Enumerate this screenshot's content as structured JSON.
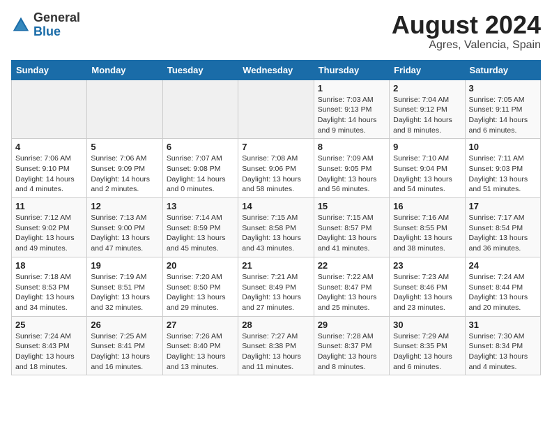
{
  "logo": {
    "general": "General",
    "blue": "Blue"
  },
  "title": "August 2024",
  "subtitle": "Agres, Valencia, Spain",
  "weekdays": [
    "Sunday",
    "Monday",
    "Tuesday",
    "Wednesday",
    "Thursday",
    "Friday",
    "Saturday"
  ],
  "weeks": [
    [
      {
        "day": "",
        "info": ""
      },
      {
        "day": "",
        "info": ""
      },
      {
        "day": "",
        "info": ""
      },
      {
        "day": "",
        "info": ""
      },
      {
        "day": "1",
        "info": "Sunrise: 7:03 AM\nSunset: 9:13 PM\nDaylight: 14 hours\nand 9 minutes."
      },
      {
        "day": "2",
        "info": "Sunrise: 7:04 AM\nSunset: 9:12 PM\nDaylight: 14 hours\nand 8 minutes."
      },
      {
        "day": "3",
        "info": "Sunrise: 7:05 AM\nSunset: 9:11 PM\nDaylight: 14 hours\nand 6 minutes."
      }
    ],
    [
      {
        "day": "4",
        "info": "Sunrise: 7:06 AM\nSunset: 9:10 PM\nDaylight: 14 hours\nand 4 minutes."
      },
      {
        "day": "5",
        "info": "Sunrise: 7:06 AM\nSunset: 9:09 PM\nDaylight: 14 hours\nand 2 minutes."
      },
      {
        "day": "6",
        "info": "Sunrise: 7:07 AM\nSunset: 9:08 PM\nDaylight: 14 hours\nand 0 minutes."
      },
      {
        "day": "7",
        "info": "Sunrise: 7:08 AM\nSunset: 9:06 PM\nDaylight: 13 hours\nand 58 minutes."
      },
      {
        "day": "8",
        "info": "Sunrise: 7:09 AM\nSunset: 9:05 PM\nDaylight: 13 hours\nand 56 minutes."
      },
      {
        "day": "9",
        "info": "Sunrise: 7:10 AM\nSunset: 9:04 PM\nDaylight: 13 hours\nand 54 minutes."
      },
      {
        "day": "10",
        "info": "Sunrise: 7:11 AM\nSunset: 9:03 PM\nDaylight: 13 hours\nand 51 minutes."
      }
    ],
    [
      {
        "day": "11",
        "info": "Sunrise: 7:12 AM\nSunset: 9:02 PM\nDaylight: 13 hours\nand 49 minutes."
      },
      {
        "day": "12",
        "info": "Sunrise: 7:13 AM\nSunset: 9:00 PM\nDaylight: 13 hours\nand 47 minutes."
      },
      {
        "day": "13",
        "info": "Sunrise: 7:14 AM\nSunset: 8:59 PM\nDaylight: 13 hours\nand 45 minutes."
      },
      {
        "day": "14",
        "info": "Sunrise: 7:15 AM\nSunset: 8:58 PM\nDaylight: 13 hours\nand 43 minutes."
      },
      {
        "day": "15",
        "info": "Sunrise: 7:15 AM\nSunset: 8:57 PM\nDaylight: 13 hours\nand 41 minutes."
      },
      {
        "day": "16",
        "info": "Sunrise: 7:16 AM\nSunset: 8:55 PM\nDaylight: 13 hours\nand 38 minutes."
      },
      {
        "day": "17",
        "info": "Sunrise: 7:17 AM\nSunset: 8:54 PM\nDaylight: 13 hours\nand 36 minutes."
      }
    ],
    [
      {
        "day": "18",
        "info": "Sunrise: 7:18 AM\nSunset: 8:53 PM\nDaylight: 13 hours\nand 34 minutes."
      },
      {
        "day": "19",
        "info": "Sunrise: 7:19 AM\nSunset: 8:51 PM\nDaylight: 13 hours\nand 32 minutes."
      },
      {
        "day": "20",
        "info": "Sunrise: 7:20 AM\nSunset: 8:50 PM\nDaylight: 13 hours\nand 29 minutes."
      },
      {
        "day": "21",
        "info": "Sunrise: 7:21 AM\nSunset: 8:49 PM\nDaylight: 13 hours\nand 27 minutes."
      },
      {
        "day": "22",
        "info": "Sunrise: 7:22 AM\nSunset: 8:47 PM\nDaylight: 13 hours\nand 25 minutes."
      },
      {
        "day": "23",
        "info": "Sunrise: 7:23 AM\nSunset: 8:46 PM\nDaylight: 13 hours\nand 23 minutes."
      },
      {
        "day": "24",
        "info": "Sunrise: 7:24 AM\nSunset: 8:44 PM\nDaylight: 13 hours\nand 20 minutes."
      }
    ],
    [
      {
        "day": "25",
        "info": "Sunrise: 7:24 AM\nSunset: 8:43 PM\nDaylight: 13 hours\nand 18 minutes."
      },
      {
        "day": "26",
        "info": "Sunrise: 7:25 AM\nSunset: 8:41 PM\nDaylight: 13 hours\nand 16 minutes."
      },
      {
        "day": "27",
        "info": "Sunrise: 7:26 AM\nSunset: 8:40 PM\nDaylight: 13 hours\nand 13 minutes."
      },
      {
        "day": "28",
        "info": "Sunrise: 7:27 AM\nSunset: 8:38 PM\nDaylight: 13 hours\nand 11 minutes."
      },
      {
        "day": "29",
        "info": "Sunrise: 7:28 AM\nSunset: 8:37 PM\nDaylight: 13 hours\nand 8 minutes."
      },
      {
        "day": "30",
        "info": "Sunrise: 7:29 AM\nSunset: 8:35 PM\nDaylight: 13 hours\nand 6 minutes."
      },
      {
        "day": "31",
        "info": "Sunrise: 7:30 AM\nSunset: 8:34 PM\nDaylight: 13 hours\nand 4 minutes."
      }
    ]
  ]
}
